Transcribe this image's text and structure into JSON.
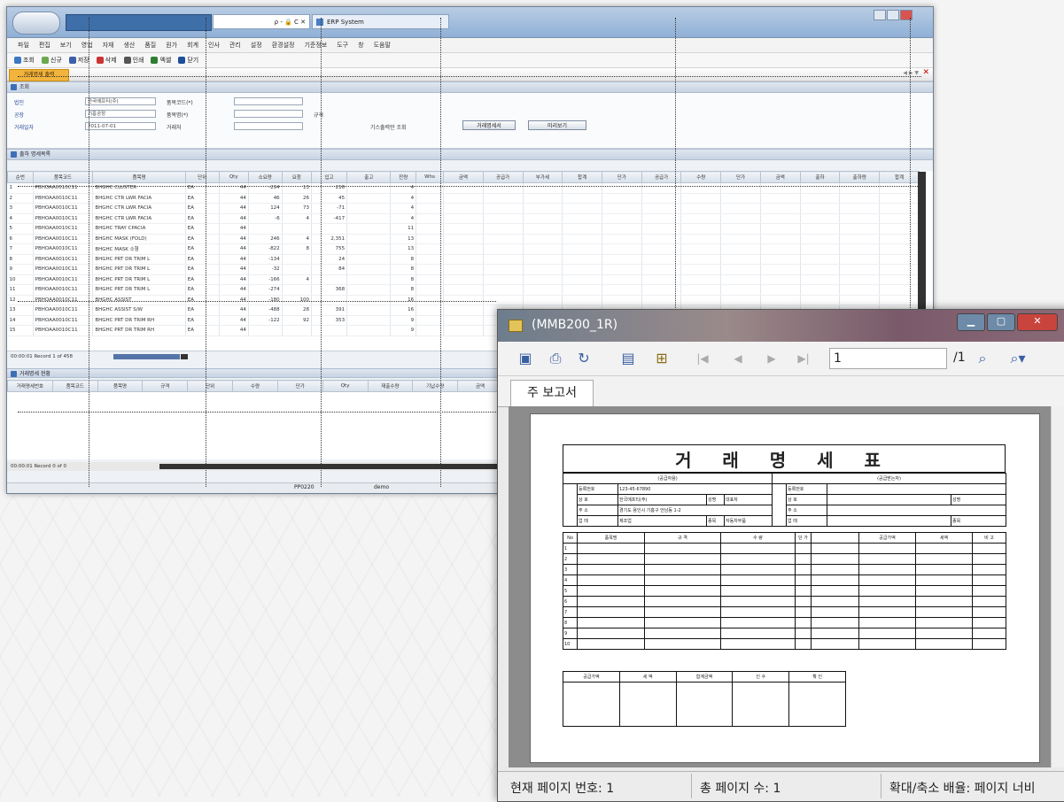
{
  "erp": {
    "tab_title": "ERP System",
    "address_text": "ρ - 🔒 C ✕",
    "menu": [
      "파일",
      "편집",
      "보기",
      "영업",
      "자재",
      "생산",
      "품질",
      "원가",
      "회계",
      "인사",
      "관리",
      "설정",
      "환경설정",
      "기준정보",
      "도구",
      "창",
      "도움말"
    ],
    "toolbar": [
      "조회",
      "신규",
      "저장",
      "삭제",
      "인쇄",
      "엑셀",
      "닫기"
    ],
    "page_tab": "거래명세 출력",
    "section_search": "조회",
    "labels": [
      "법인",
      "공장",
      "거래일자",
      "품목코드(*)",
      "품목명(*)",
      "거래처",
      "규격",
      "기스출력만 조회"
    ],
    "fields": [
      "한국에프티(주)",
      "기흥공장",
      "2011-07-01",
      "",
      "",
      "",
      ""
    ],
    "buttons": [
      "거래명세서",
      "미리보기"
    ],
    "section_list": "출하 명세목록",
    "columns": [
      "순번",
      "품목코드",
      "품목명",
      "단위",
      "Qty",
      "소요량",
      "요청",
      "입고",
      "출고",
      "잔량",
      "Whs",
      "금액",
      "공급가",
      "부가세",
      "합계",
      "단가",
      "공급가",
      "수량",
      "단가",
      "금액",
      "출하",
      "출하량",
      "합계"
    ],
    "rows": [
      [
        "1",
        "PBHOAA0010C11",
        "BHGHC CLUSTER",
        "EA",
        "44",
        "-294",
        "13",
        "218",
        "",
        "4"
      ],
      [
        "2",
        "PBHOAA0010C11",
        "BHGHC CTR LWR FACIA",
        "EA",
        "44",
        "46",
        "26",
        "45",
        "",
        "4"
      ],
      [
        "3",
        "PBHOAA0010C11",
        "BHGHC CTR LWR FACIA",
        "EA",
        "44",
        "124",
        "73",
        "-71",
        "",
        "4"
      ],
      [
        "4",
        "PBHOAA0010C11",
        "BHGHC CTR LWR FACIA",
        "EA",
        "44",
        "-6",
        "4",
        "-417",
        "",
        "4"
      ],
      [
        "5",
        "PBHOAA0010C11",
        "BHGHC TRAY CPACIA",
        "EA",
        "44",
        "",
        "",
        "",
        "",
        "11"
      ],
      [
        "6",
        "PBHOAA0010C11",
        "BHGHC MASK (FOLD)",
        "EA",
        "44",
        "246",
        "4",
        "2,351",
        "",
        "13"
      ],
      [
        "7",
        "PBHOAA0010C11",
        "BHGHC MASK 소형",
        "EA",
        "44",
        "-822",
        "8",
        "755",
        "",
        "13"
      ],
      [
        "8",
        "PBHOAA0010C11",
        "BHGHC PRT DR TRIM L",
        "EA",
        "44",
        "-134",
        "",
        "24",
        "",
        "8"
      ],
      [
        "9",
        "PBHOAA0010C11",
        "BHGHC PRT DR TRIM L",
        "EA",
        "44",
        "-32",
        "",
        "84",
        "",
        "8"
      ],
      [
        "10",
        "PBHOAA0010C11",
        "BHGHC PRT DR TRIM L",
        "EA",
        "44",
        "-166",
        "4",
        "",
        "",
        "8"
      ],
      [
        "11",
        "PBHOAA0010C11",
        "BHGHC PRT DR TRIM L",
        "EA",
        "44",
        "-274",
        "",
        "368",
        "",
        "8"
      ],
      [
        "12",
        "PBHOAA0010C11",
        "BHGHC ASSIST",
        "EA",
        "44",
        "-180",
        "100",
        "",
        "",
        "16"
      ],
      [
        "13",
        "PBHOAA0010C11",
        "BHGHC ASSIST S/W",
        "EA",
        "44",
        "-488",
        "28",
        "391",
        "",
        "16"
      ],
      [
        "14",
        "PBHOAA0010C11",
        "BHGHC PRT DR TRIM RH",
        "EA",
        "44",
        "-122",
        "92",
        "353",
        "",
        "9"
      ],
      [
        "15",
        "PBHOAA0010C11",
        "BHGHC PRT DR TRIM RH",
        "EA",
        "44",
        "",
        "",
        "",
        "",
        "9"
      ]
    ],
    "record_text_1": "00:00:01  Record 1 of 458",
    "section_detail": "거래명세 현황",
    "detail_columns": [
      "거래명세번호",
      "품목코드",
      "품목명",
      "규격",
      "단위",
      "수량",
      "단가",
      "Qty",
      "재출수량",
      "기납수량",
      "금액"
    ],
    "record_text_2": "00:00:01  Record 0 of 0",
    "status": [
      "PP0220",
      "demo"
    ]
  },
  "report": {
    "window_title": "(MMB200_1R)",
    "page_current": "1",
    "page_total": "/1",
    "tab_label": "주 보고서",
    "doc_title": "거 래 명 세 표",
    "sub_supplier": "(공급자용)",
    "sub_receiver": "(공급받는자)",
    "supplier_rows": [
      [
        "등록번호",
        "123-45-67890",
        "",
        ""
      ],
      [
        "상 호",
        "한국에프티(주)",
        "성명",
        "대표자"
      ],
      [
        "주 소",
        "경기도 용인시 기흥구 언남동 1-2",
        "",
        ""
      ],
      [
        "업 태",
        "제조업",
        "종목",
        "자동차부품"
      ]
    ],
    "receiver_rows": [
      [
        "등록번호",
        "",
        ""
      ],
      [
        "상 호",
        "",
        "성명"
      ],
      [
        "주 소",
        "",
        ""
      ],
      [
        "업 태",
        "",
        "종목"
      ]
    ],
    "item_header": [
      "No",
      "품목명",
      "규 격",
      "수 량",
      "단 가",
      "공급가액",
      "세액",
      "비 고"
    ],
    "item_rows": [
      "1",
      "2",
      "3",
      "4",
      "5",
      "6",
      "7",
      "8",
      "9",
      "10"
    ],
    "footer_header": [
      "공급가액",
      "세 액",
      "합계금액",
      "인 수",
      "확 인"
    ],
    "status_page": "현재 페이지 번호: 1",
    "status_total": "총 페이지 수: 1",
    "status_zoom": "확대/축소 배율: 페이지 너비"
  }
}
